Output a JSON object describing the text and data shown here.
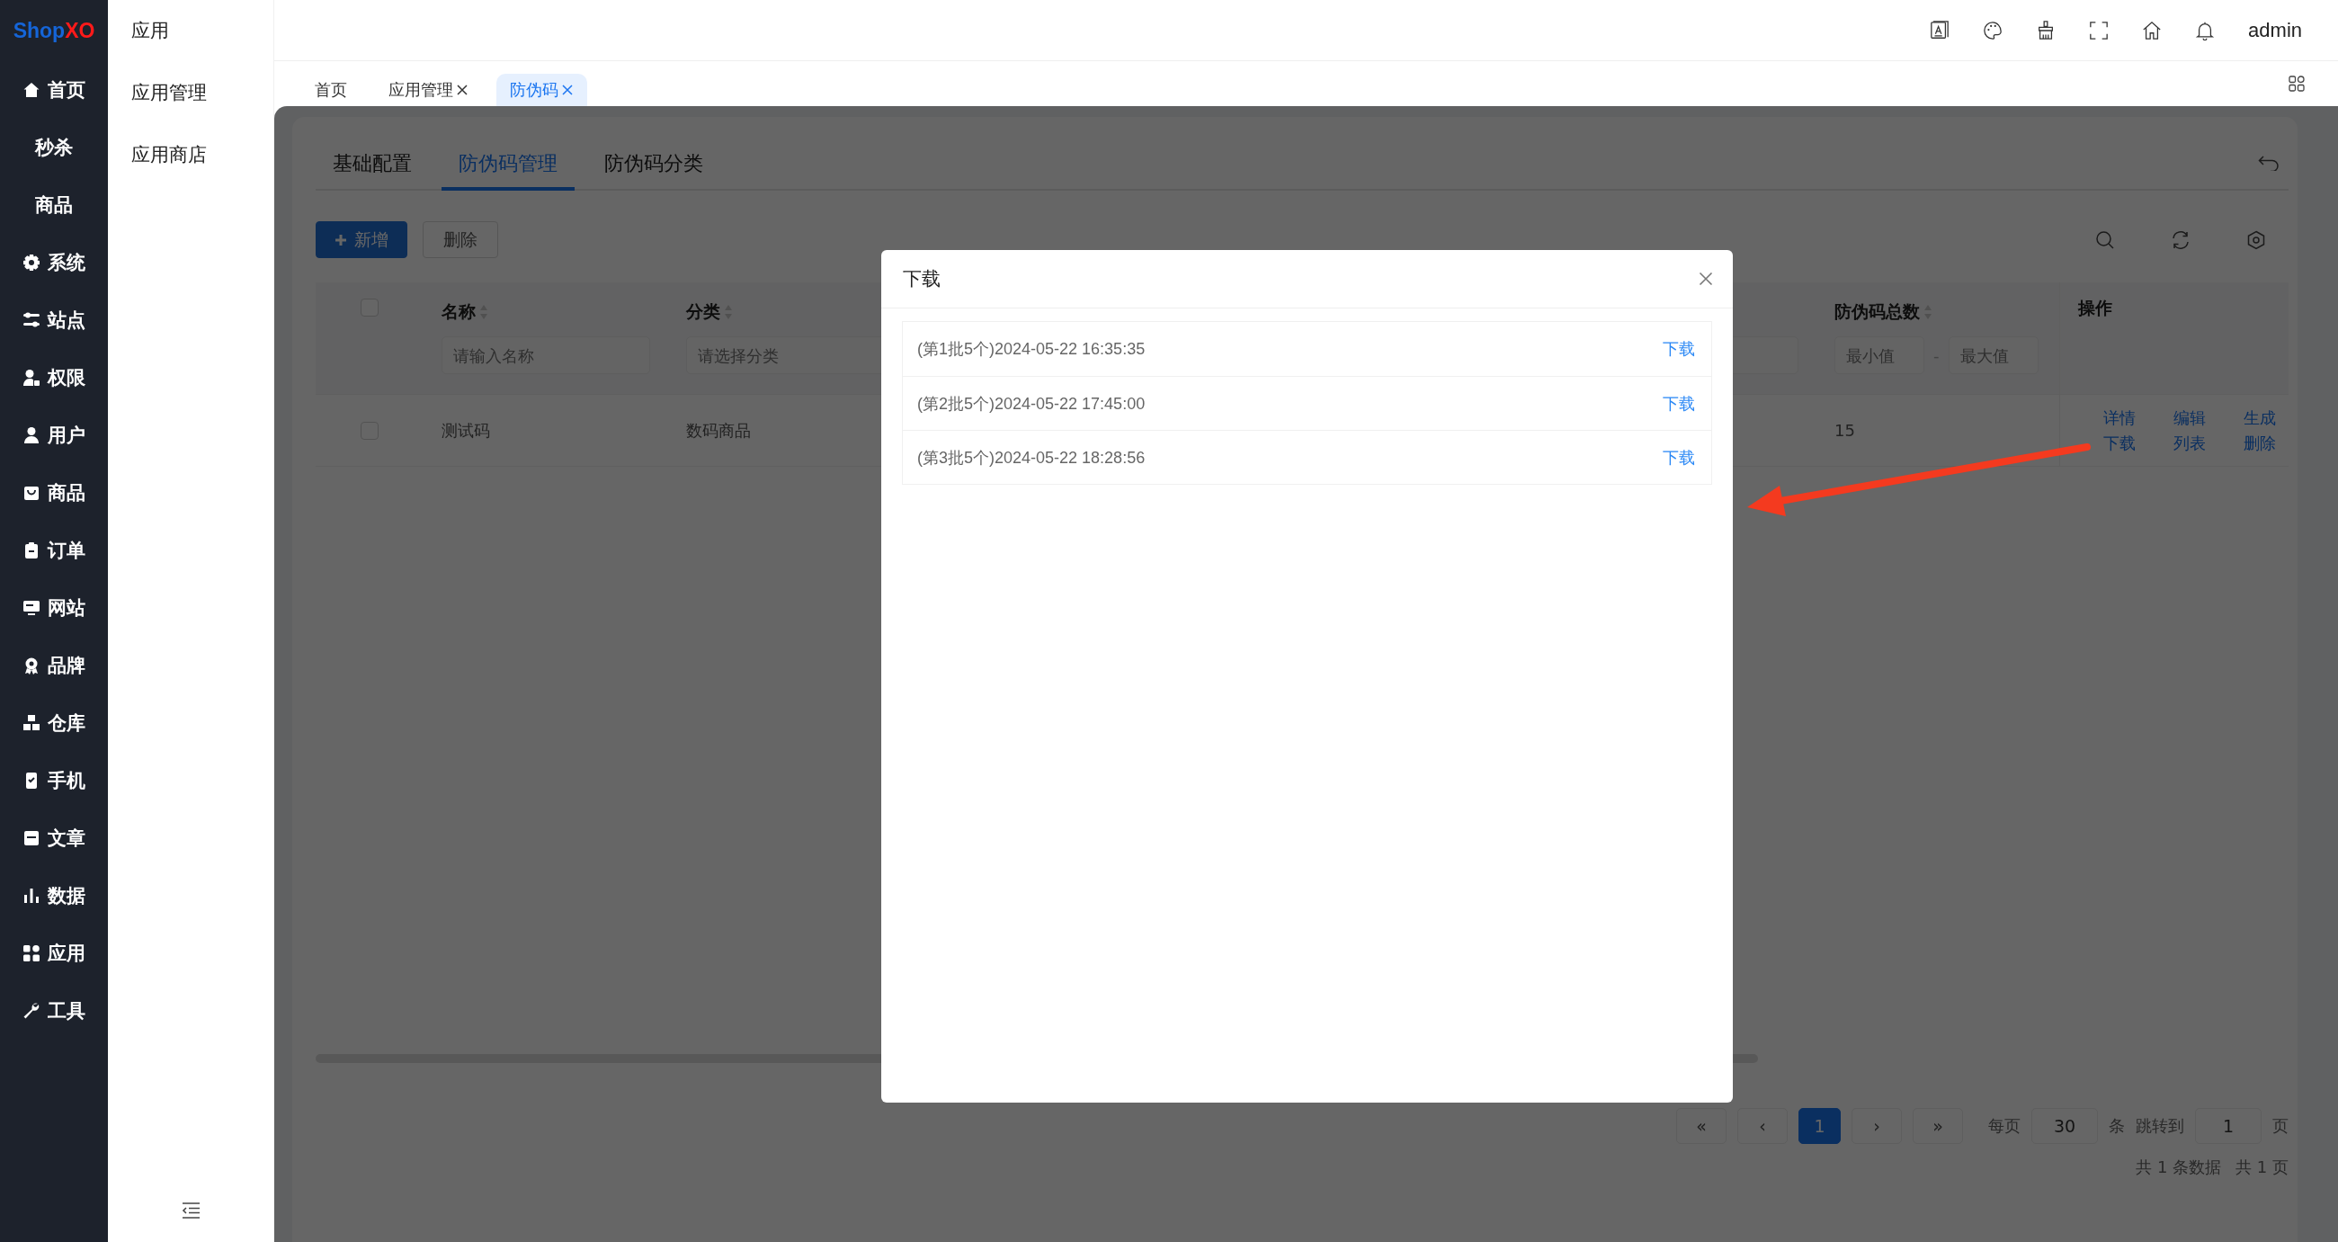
{
  "logo": [
    {
      "text": "Shop",
      "color": "#1565d8"
    },
    {
      "text": "XO",
      "color": "#ff1a1a"
    }
  ],
  "main_menu": [
    {
      "label": "首页",
      "icon": true
    },
    {
      "label": "秒杀",
      "icon": false
    },
    {
      "label": "商品",
      "icon": false
    },
    {
      "label": "系统",
      "icon": true
    },
    {
      "label": "站点",
      "icon": true
    },
    {
      "label": "权限",
      "icon": true
    },
    {
      "label": "用户",
      "icon": true
    },
    {
      "label": "商品",
      "icon": true
    },
    {
      "label": "订单",
      "icon": true
    },
    {
      "label": "网站",
      "icon": true
    },
    {
      "label": "品牌",
      "icon": true
    },
    {
      "label": "仓库",
      "icon": true
    },
    {
      "label": "手机",
      "icon": true
    },
    {
      "label": "文章",
      "icon": true
    },
    {
      "label": "数据",
      "icon": true
    },
    {
      "label": "应用",
      "icon": true
    },
    {
      "label": "工具",
      "icon": true
    }
  ],
  "sub_menu": {
    "title": "应用",
    "items": [
      "应用管理",
      "应用商店"
    ]
  },
  "top_bar": {
    "user": "admin"
  },
  "page_tabs": [
    {
      "label": "首页",
      "closable": false,
      "selected": false
    },
    {
      "label": "应用管理",
      "closable": true,
      "selected": false
    },
    {
      "label": "防伪码",
      "closable": true,
      "selected": true
    }
  ],
  "content_tabs": [
    {
      "label": "基础配置",
      "selected": false
    },
    {
      "label": "防伪码管理",
      "selected": true
    },
    {
      "label": "防伪码分类",
      "selected": false
    }
  ],
  "toolbar": {
    "buttons": [
      {
        "label": "新增",
        "kind": "primary"
      },
      {
        "label": "删除",
        "kind": "default"
      }
    ]
  },
  "table": {
    "select_all_checked": false,
    "columns": [
      {
        "label": "名称",
        "sortable": true,
        "filter": {
          "kind": "text",
          "placeholder": "请输入名称"
        }
      },
      {
        "label": "分类",
        "sortable": true,
        "filter": {
          "kind": "select",
          "placeholder": "请选择分类"
        }
      },
      {
        "label": "防伪码总数",
        "sortable": true,
        "filter": {
          "kind": "range",
          "placeholder": "最小值",
          "placeholder_2": "最大值",
          "separator": "-"
        }
      },
      {
        "label": "操作",
        "sortable": false
      }
    ],
    "rows": [
      {
        "checked": false,
        "cells": [
          "测试码",
          "数码商品",
          "15"
        ],
        "actions": [
          "详情",
          "编辑",
          "生成",
          "下载",
          "列表",
          "删除"
        ]
      }
    ]
  },
  "pagination": {
    "pages": [
      {
        "label": "«",
        "selected": false
      },
      {
        "label": "‹",
        "selected": false
      },
      {
        "label": "1",
        "selected": true
      },
      {
        "label": "›",
        "selected": false
      },
      {
        "label": "»",
        "selected": false
      }
    ],
    "per_page_label": "每页",
    "per_page": "30",
    "per_page_unit": "条",
    "jump_label": "跳转到",
    "jump_page": "1",
    "jump_unit": "页",
    "total_rows": "共 1 条数据",
    "total_pages": "共 1 页"
  },
  "modal": {
    "title": "下载",
    "items": [
      {
        "text": "(第1批5个)2024-05-22 16:35:35",
        "action": "下载"
      },
      {
        "text": "(第2批5个)2024-05-22 17:45:00",
        "action": "下载"
      },
      {
        "text": "(第3批5个)2024-05-22 18:28:56",
        "action": "下载"
      }
    ]
  },
  "annotation": {
    "kind": "arrow"
  }
}
